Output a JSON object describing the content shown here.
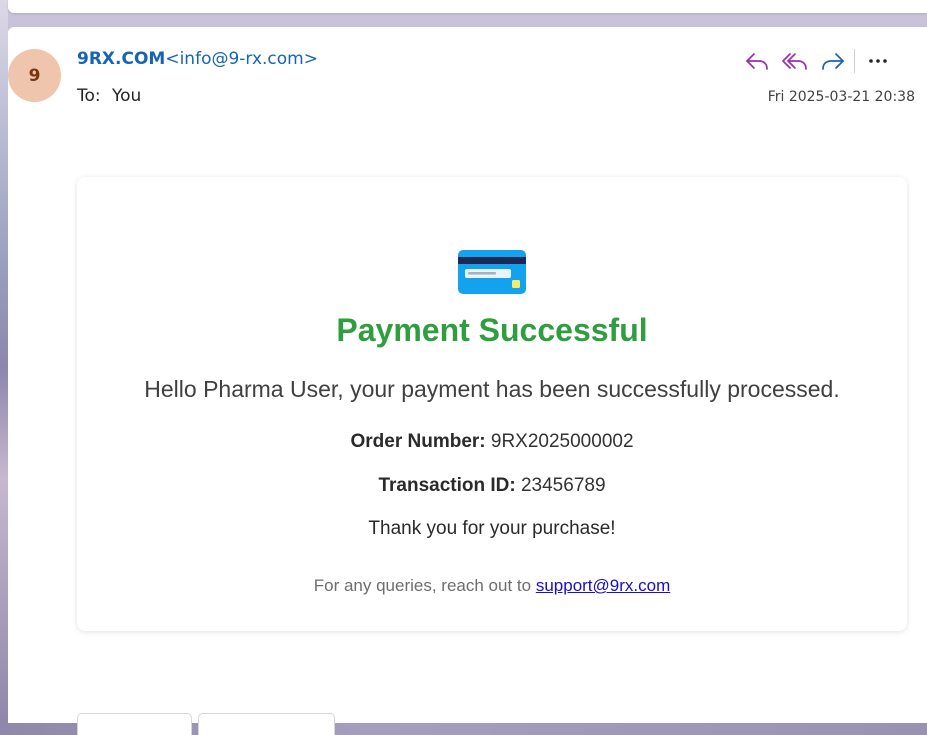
{
  "sender": {
    "avatar_initial": "9",
    "name": "9RX.COM",
    "email": "<info@9-rx.com>"
  },
  "recipient": {
    "label": "To:",
    "value": "You"
  },
  "date": "Fri 2025-03-21 20:38",
  "actions": [
    {
      "name": "reply-icon",
      "color": "#9b2fae"
    },
    {
      "name": "reply-all-icon",
      "color": "#9b2fae"
    },
    {
      "name": "forward-icon",
      "color": "#1764b5"
    },
    {
      "name": "more-options-icon",
      "color": "#242424"
    }
  ],
  "email_body": {
    "icon": "credit-card-icon",
    "title": "Payment Successful",
    "title_color": "#2e9e3f",
    "greeting": "Hello Pharma User, your payment has been successfully processed.",
    "order_label": "Order Number:",
    "order_value": "9RX2025000002",
    "transaction_label": "Transaction ID:",
    "transaction_value": "23456789",
    "thanks": "Thank you for your purchase!",
    "queries_text": "For any queries, reach out to",
    "support_email": "support@9rx.com"
  }
}
